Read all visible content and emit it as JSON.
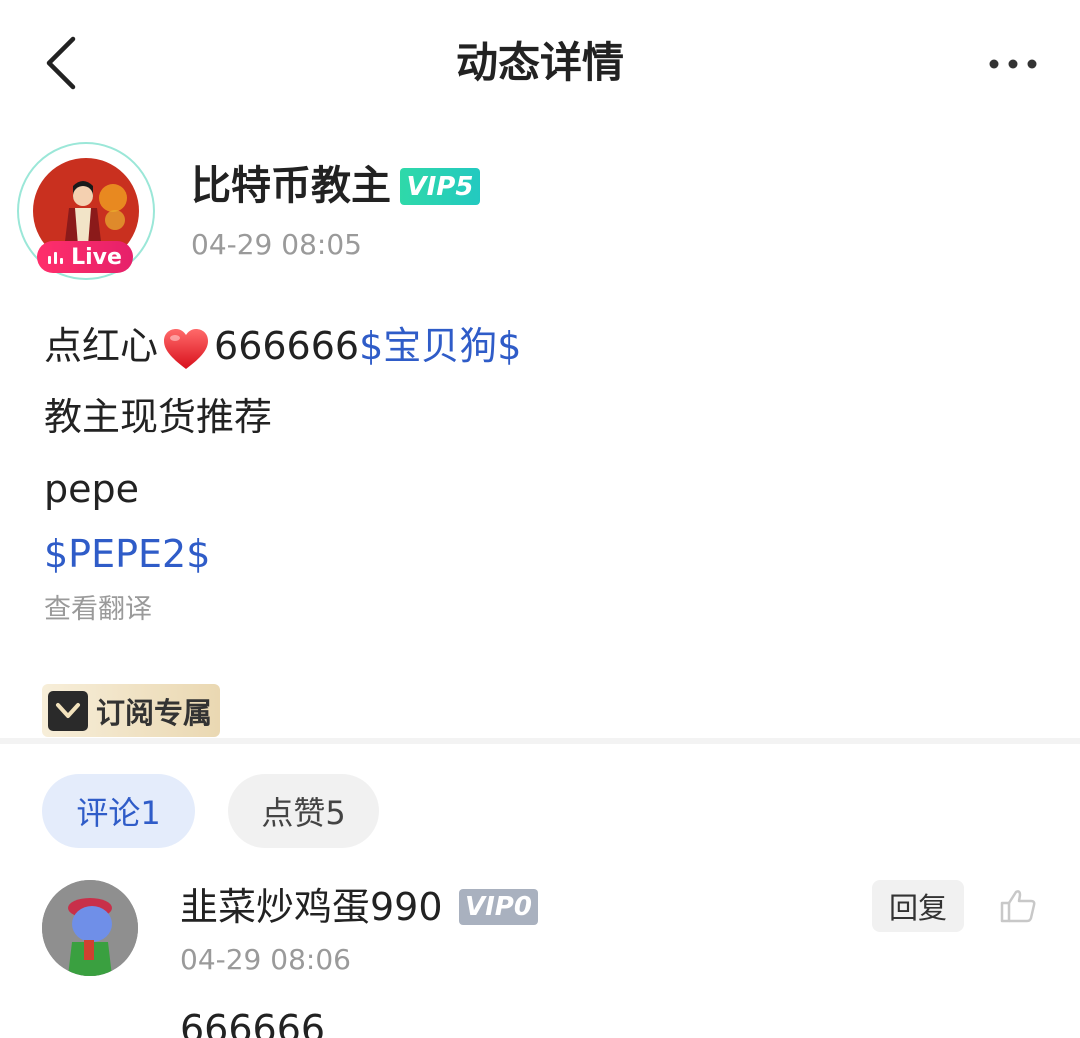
{
  "header": {
    "title": "动态详情"
  },
  "author": {
    "name": "比特币教主",
    "vip": "VIP5",
    "live_label": "Live",
    "time": "04-29 08:05"
  },
  "post": {
    "line1_prefix": "点红心",
    "line1_number": "666666",
    "line1_tag": "$宝贝狗$",
    "line2": "教主现货推荐",
    "line3": "pepe",
    "line4_tag": "$PEPE2$",
    "translate": "查看翻译",
    "subscription_badge": "订阅专属"
  },
  "tabs": {
    "comments": "评论1",
    "likes": "点赞5"
  },
  "comment": {
    "name": "韭菜炒鸡蛋990",
    "vip": "VIP0",
    "time": "04-29 08:06",
    "reply": "回复",
    "text": "666666"
  },
  "colors": {
    "link": "#2f5cc8",
    "vip5": "#2fd9a9",
    "vip0": "#a9b1bf",
    "live": "#ff2f6b"
  }
}
